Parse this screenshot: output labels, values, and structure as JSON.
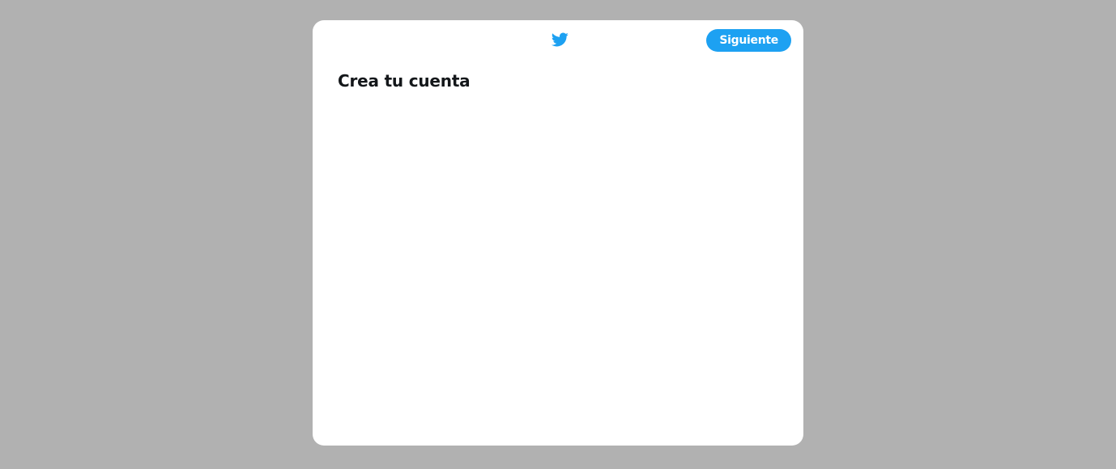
{
  "header": {
    "logo_icon": "twitter-bird-icon",
    "next_label": "Siguiente"
  },
  "main": {
    "title": "Crea tu cuenta"
  },
  "colors": {
    "accent": "#1da1f2",
    "backdrop": "#b1b1b1",
    "modal_bg": "#ffffff",
    "title_text": "#14171a"
  }
}
